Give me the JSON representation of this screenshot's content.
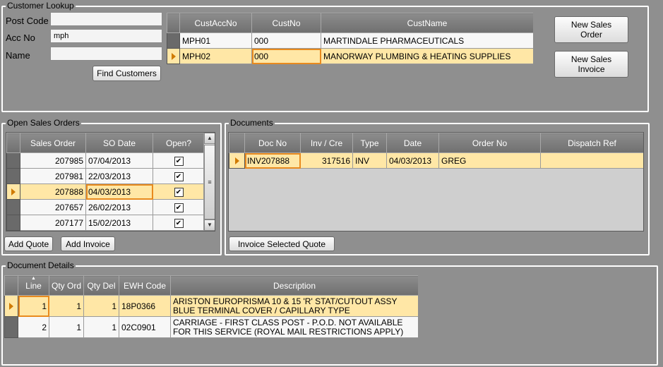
{
  "customer_lookup": {
    "title": "Customer Lookup",
    "post_code_label": "Post Code",
    "post_code_value": "",
    "acc_no_label": "Acc No",
    "acc_no_value": "mph",
    "name_label": "Name",
    "name_value": "",
    "find_button": "Find Customers",
    "grid": {
      "columns": [
        "CustAccNo",
        "CustNo",
        "CustName"
      ],
      "rows": [
        {
          "acc": "MPH01",
          "no": "000",
          "name": "MARTINDALE PHARMACEUTICALS",
          "selected": false
        },
        {
          "acc": "MPH02",
          "no": "000",
          "name": "MANORWAY PLUMBING & HEATING SUPPLIES",
          "selected": true
        }
      ]
    },
    "new_sales_order_button": "New Sales Order",
    "new_sales_invoice_button": "New Sales Invoice"
  },
  "open_sales_orders": {
    "title": "Open Sales Orders",
    "columns": [
      "Sales Order",
      "SO Date",
      "Open?"
    ],
    "rows": [
      {
        "order": "207985",
        "date": "07/04/2013",
        "open": true,
        "selected": false
      },
      {
        "order": "207981",
        "date": "22/03/2013",
        "open": true,
        "selected": false
      },
      {
        "order": "207888",
        "date": "04/03/2013",
        "open": true,
        "selected": true
      },
      {
        "order": "207657",
        "date": "26/02/2013",
        "open": true,
        "selected": false
      },
      {
        "order": "207177",
        "date": "15/02/2013",
        "open": true,
        "selected": false
      }
    ],
    "add_quote_button": "Add Quote",
    "add_invoice_button": "Add Invoice"
  },
  "documents": {
    "title": "Documents",
    "columns": [
      "Doc No",
      "Inv / Cre",
      "Type",
      "Date",
      "Order No",
      "Dispatch Ref"
    ],
    "rows": [
      {
        "doc": "INV207888",
        "invcre": "317516",
        "type": "INV",
        "date": "04/03/2013",
        "order": "GREG",
        "dispatch": "",
        "selected": true
      }
    ],
    "invoice_selected_quote_button": "Invoice Selected Quote"
  },
  "document_details": {
    "title": "Document Details",
    "columns": [
      "Line",
      "Qty Ord",
      "Qty Del",
      "EWH Code",
      "Description"
    ],
    "rows": [
      {
        "line": "1",
        "qty_ord": "1",
        "qty_del": "1",
        "ewh": "18P0366",
        "desc1": "ARISTON EUROPRISMA 10 & 15 'R' STAT/CUTOUT ASSY",
        "desc2": "BLUE TERMINAL COVER / CAPILLARY TYPE",
        "selected": true
      },
      {
        "line": "2",
        "qty_ord": "1",
        "qty_del": "1",
        "ewh": "02C0901",
        "desc1": "CARRIAGE - FIRST CLASS POST - P.O.D. NOT AVAILABLE",
        "desc2": "FOR THIS SERVICE (ROYAL MAIL RESTRICTIONS APPLY)",
        "selected": false
      }
    ]
  },
  "colors": {
    "background": "#8f8f8f",
    "selected_row": "#ffe7a6",
    "focus_outline": "#e88a1e",
    "header": "#7a7a7a"
  }
}
